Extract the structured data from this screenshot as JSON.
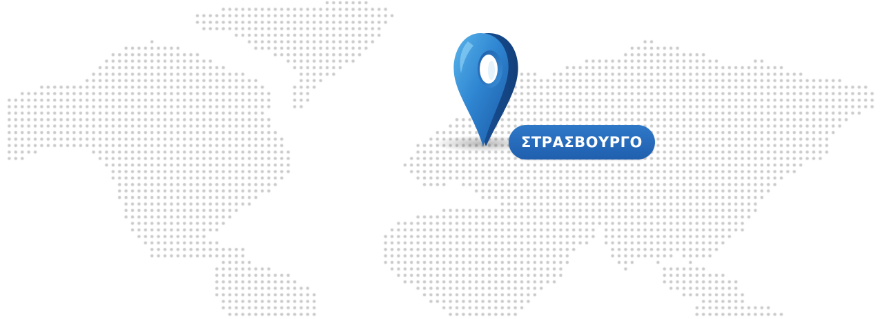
{
  "map": {
    "dot_color": "#c9c9c9",
    "accent_color": "#2a6fbe"
  },
  "location": {
    "label": "ΣΤΡΑΣΒΟΥΡΓΟ",
    "icon": "map-pin-icon"
  }
}
